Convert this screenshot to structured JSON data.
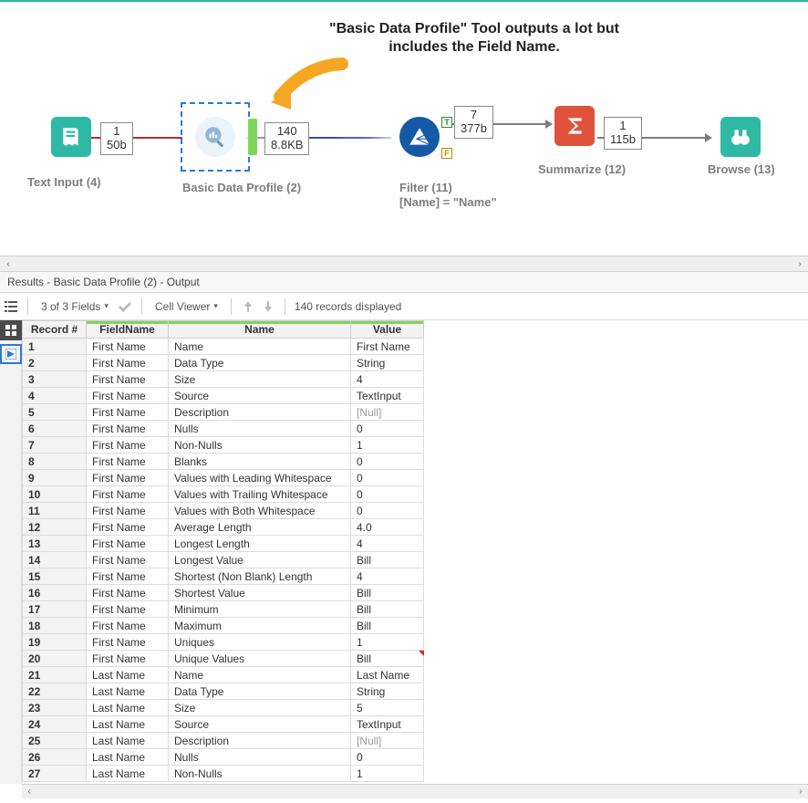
{
  "canvas": {
    "callout": "\"Basic Data Profile\" Tool outputs a lot but includes the Field Name.",
    "tools": {
      "text_input": {
        "label": "Text Input (4)",
        "count": "1",
        "size": "50b"
      },
      "basic_profile": {
        "label": "Basic Data Profile (2)",
        "count": "140",
        "size": "8.8KB"
      },
      "filter": {
        "label": "Filter (11)",
        "sub": "[Name] = \"Name\"",
        "count": "7",
        "size": "377b"
      },
      "summarize": {
        "label": "Summarize (12)",
        "count": "1",
        "size": "115b"
      },
      "browse": {
        "label": "Browse (13)"
      }
    }
  },
  "results_title": "Results - Basic Data Profile (2) - Output",
  "toolbar": {
    "fields": "3 of 3 Fields",
    "cell_viewer": "Cell Viewer",
    "records": "140 records displayed"
  },
  "columns": [
    "Record #",
    "FieldName",
    "Name",
    "Value"
  ],
  "rows": [
    {
      "n": "1",
      "f": "First Name",
      "name": "Name",
      "v": "First Name"
    },
    {
      "n": "2",
      "f": "First Name",
      "name": "Data Type",
      "v": "String"
    },
    {
      "n": "3",
      "f": "First Name",
      "name": "Size",
      "v": "4"
    },
    {
      "n": "4",
      "f": "First Name",
      "name": "Source",
      "v": "TextInput"
    },
    {
      "n": "5",
      "f": "First Name",
      "name": "Description",
      "v": "[Null]",
      "null": true
    },
    {
      "n": "6",
      "f": "First Name",
      "name": "Nulls",
      "v": "0"
    },
    {
      "n": "7",
      "f": "First Name",
      "name": "Non-Nulls",
      "v": "1"
    },
    {
      "n": "8",
      "f": "First Name",
      "name": "Blanks",
      "v": "0"
    },
    {
      "n": "9",
      "f": "First Name",
      "name": "Values with Leading Whitespace",
      "v": "0"
    },
    {
      "n": "10",
      "f": "First Name",
      "name": "Values with Trailing Whitespace",
      "v": "0"
    },
    {
      "n": "11",
      "f": "First Name",
      "name": "Values with Both Whitespace",
      "v": "0"
    },
    {
      "n": "12",
      "f": "First Name",
      "name": "Average Length",
      "v": "4.0"
    },
    {
      "n": "13",
      "f": "First Name",
      "name": "Longest Length",
      "v": "4"
    },
    {
      "n": "14",
      "f": "First Name",
      "name": "Longest Value",
      "v": "Bill"
    },
    {
      "n": "15",
      "f": "First Name",
      "name": "Shortest (Non Blank) Length",
      "v": "4"
    },
    {
      "n": "16",
      "f": "First Name",
      "name": "Shortest Value",
      "v": "Bill"
    },
    {
      "n": "17",
      "f": "First Name",
      "name": "Minimum",
      "v": "Bill"
    },
    {
      "n": "18",
      "f": "First Name",
      "name": "Maximum",
      "v": "Bill"
    },
    {
      "n": "19",
      "f": "First Name",
      "name": "Uniques",
      "v": "1"
    },
    {
      "n": "20",
      "f": "First Name",
      "name": "Unique Values",
      "v": "Bill"
    },
    {
      "n": "21",
      "f": "Last Name",
      "name": "Name",
      "v": "Last Name"
    },
    {
      "n": "22",
      "f": "Last Name",
      "name": "Data Type",
      "v": "String"
    },
    {
      "n": "23",
      "f": "Last Name",
      "name": "Size",
      "v": "5"
    },
    {
      "n": "24",
      "f": "Last Name",
      "name": "Source",
      "v": "TextInput"
    },
    {
      "n": "25",
      "f": "Last Name",
      "name": "Description",
      "v": "[Null]",
      "null": true
    },
    {
      "n": "26",
      "f": "Last Name",
      "name": "Nulls",
      "v": "0"
    },
    {
      "n": "27",
      "f": "Last Name",
      "name": "Non-Nulls",
      "v": "1"
    }
  ]
}
